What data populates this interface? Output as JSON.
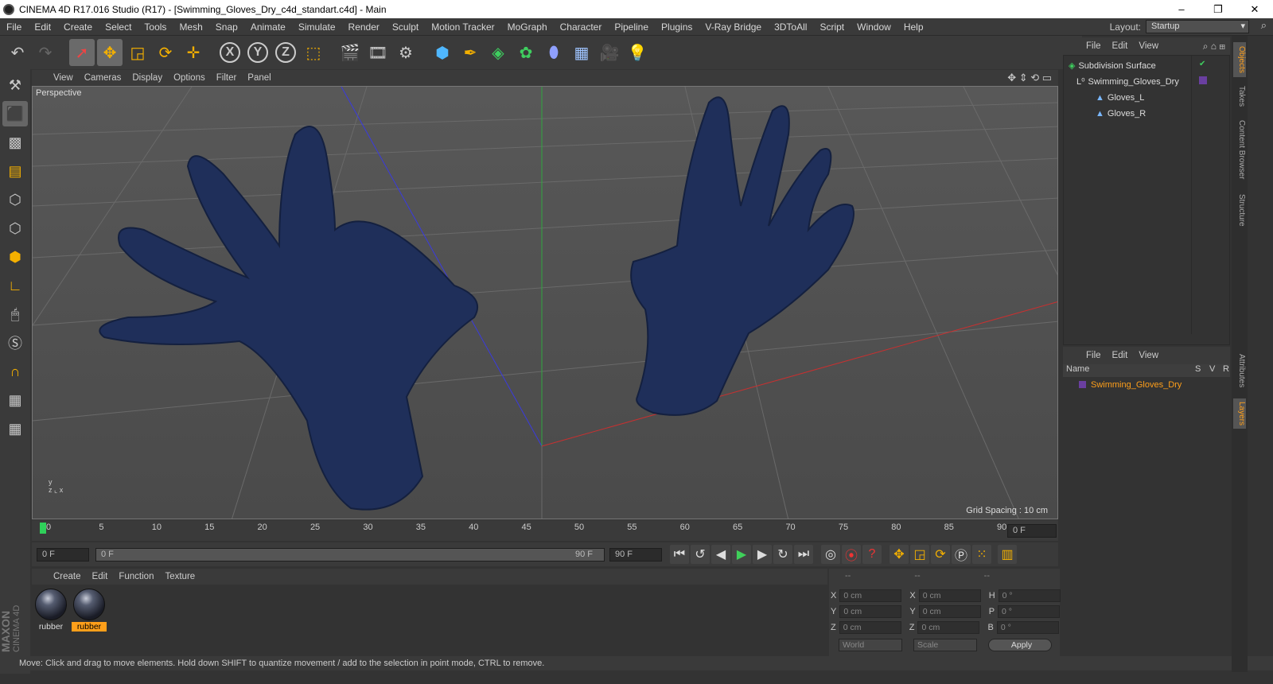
{
  "window": {
    "title": "CINEMA 4D R17.016 Studio (R17) - [Swimming_Gloves_Dry_c4d_standart.c4d] - Main",
    "controls": [
      "–",
      "❐",
      "✕"
    ]
  },
  "menubar": {
    "items": [
      "File",
      "Edit",
      "Create",
      "Select",
      "Tools",
      "Mesh",
      "Snap",
      "Animate",
      "Simulate",
      "Render",
      "Sculpt",
      "Motion Tracker",
      "MoGraph",
      "Character",
      "Pipeline",
      "Plugins",
      "V-Ray Bridge",
      "3DToAll",
      "Script",
      "Window",
      "Help"
    ],
    "layout_label": "Layout:",
    "layout_value": "Startup"
  },
  "toolbar": {
    "icons": [
      "undo-icon",
      "redo-icon",
      "select-cursor-icon",
      "move-icon",
      "scale-icon",
      "rotate-icon",
      "live-selection-icon",
      "x-axis-icon",
      "y-axis-icon",
      "z-axis-icon",
      "coordinate-system-icon",
      "render-view-icon",
      "render-picture-viewer-icon",
      "render-settings-icon",
      "cube-primitive-icon",
      "spline-pen-icon",
      "subdivision-icon",
      "mograph-cloner-icon",
      "deformer-icon",
      "floor-icon",
      "camera-icon",
      "light-icon"
    ],
    "labels": {
      "x": "X",
      "y": "Y",
      "z": "Z"
    }
  },
  "viewport": {
    "menu": [
      "View",
      "Cameras",
      "Display",
      "Options",
      "Filter",
      "Panel"
    ],
    "label": "Perspective",
    "grid_spacing": "Grid Spacing : 10 cm"
  },
  "timeline": {
    "ticks": [
      "0",
      "5",
      "10",
      "15",
      "20",
      "25",
      "30",
      "35",
      "40",
      "45",
      "50",
      "55",
      "60",
      "65",
      "70",
      "75",
      "80",
      "85",
      "90"
    ],
    "current_frame": "0 F",
    "start_field": "0 F",
    "slider_start": "0 F",
    "slider_end": "90 F",
    "end_field": "90 F"
  },
  "materials": {
    "menu": [
      "Create",
      "Edit",
      "Function",
      "Texture"
    ],
    "items": [
      {
        "name": "rubber",
        "selected": false
      },
      {
        "name": "rubber",
        "selected": true
      }
    ]
  },
  "coords": {
    "headers": [
      "--",
      "--",
      "--"
    ],
    "rows": [
      {
        "a": "X",
        "av": "0 cm",
        "b": "X",
        "bv": "0 cm",
        "c": "H",
        "cv": "0 °"
      },
      {
        "a": "Y",
        "av": "0 cm",
        "b": "Y",
        "bv": "0 cm",
        "c": "P",
        "cv": "0 °"
      },
      {
        "a": "Z",
        "av": "0 cm",
        "b": "Z",
        "bv": "0 cm",
        "c": "B",
        "cv": "0 °"
      }
    ],
    "space": "World",
    "mode": "Scale",
    "apply": "Apply"
  },
  "status": "Move: Click and drag to move elements. Hold down SHIFT to quantize movement / add to the selection in point mode, CTRL to remove.",
  "brand": {
    "maxon": "MAXON",
    "product": "CINEMA 4D"
  },
  "objects": {
    "menu": [
      "File",
      "Edit",
      "View"
    ],
    "items": [
      {
        "name": "Subdivision Surface",
        "level": 0
      },
      {
        "name": "Swimming_Gloves_Dry",
        "level": 1
      },
      {
        "name": "Gloves_L",
        "level": 2
      },
      {
        "name": "Gloves_R",
        "level": 2
      }
    ]
  },
  "layers": {
    "menu": [
      "File",
      "Edit",
      "View"
    ],
    "columns": {
      "name": "Name",
      "s": "S",
      "v": "V",
      "r": "R"
    },
    "items": [
      {
        "name": "Swimming_Gloves_Dry"
      }
    ]
  },
  "side_tabs": [
    "Objects",
    "Takes",
    "Content Browser",
    "Structure",
    "Attributes",
    "Layers"
  ],
  "colors": {
    "accent": "#ff9f1a",
    "glove": "#1f2f5a",
    "layer_purple": "#6a3fa0"
  }
}
